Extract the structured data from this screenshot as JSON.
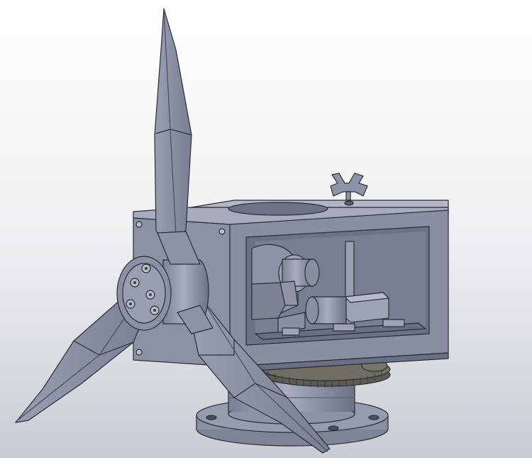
{
  "scene": {
    "subject": "",
    "background_top": "#f4f5f7",
    "background_bottom": "#c9cdd3",
    "part_color": "#8a8ea3",
    "part_light": "#a7abbd",
    "part_dark": "#62667a",
    "edge_color": "#2b2d36",
    "gear_color": "#5c5a52",
    "screw_color": "#b9bbc6"
  }
}
